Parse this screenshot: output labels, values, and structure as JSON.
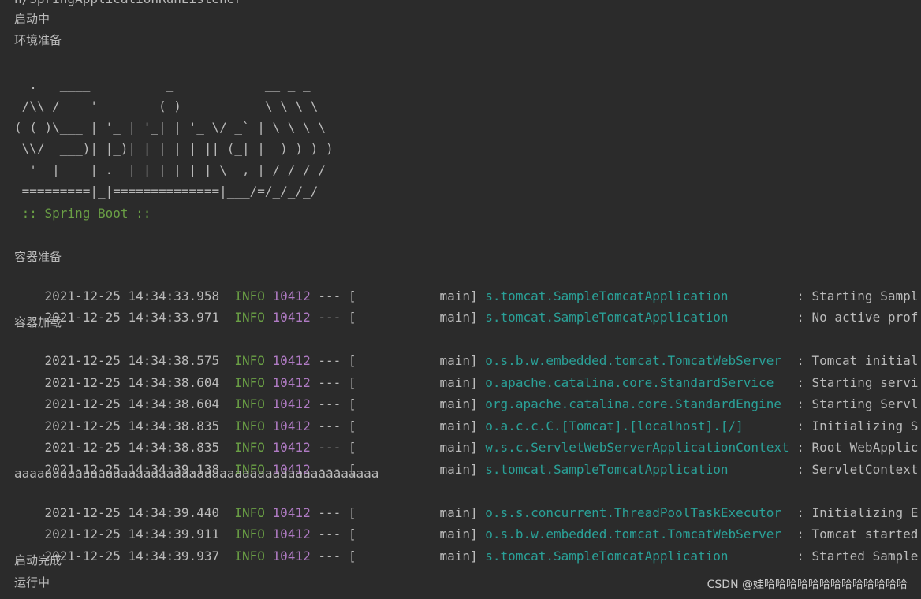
{
  "console": {
    "top_partial": "n/SpringApplicationRunListener",
    "pre_lines": [
      "启动中",
      "环境准备"
    ],
    "banner": [
      "  .   ____          _            __ _ _",
      " /\\\\ / ___'_ __ _ _(_)_ __  __ _ \\ \\ \\ \\",
      "( ( )\\___ | '_ | '_| | '_ \\/ _` | \\ \\ \\ \\",
      " \\\\/  ___)| |_)| | | | | || (_| |  ) ) ) )",
      "  '  |____| .__|_| |_|_| |_\\__, | / / / /",
      " =========|_|==============|___/=/_/_/_/",
      " :: Spring Boot :: "
    ],
    "section_container_prepare": "容器准备",
    "log_group_1": [
      {
        "ts": "2021-12-25 14:34:33.958",
        "level": "INFO",
        "pid": "10412",
        "thread": "main",
        "logger": "s.tomcat.SampleTomcatApplication",
        "msg": ": Starting Sampl"
      },
      {
        "ts": "2021-12-25 14:34:33.971",
        "level": "INFO",
        "pid": "10412",
        "thread": "main",
        "logger": "s.tomcat.SampleTomcatApplication",
        "msg": ": No active prof"
      }
    ],
    "section_container_load": "容器加载",
    "log_group_2": [
      {
        "ts": "2021-12-25 14:34:38.575",
        "level": "INFO",
        "pid": "10412",
        "thread": "main",
        "logger": "o.s.b.w.embedded.tomcat.TomcatWebServer",
        "msg": ": Tomcat initial"
      },
      {
        "ts": "2021-12-25 14:34:38.604",
        "level": "INFO",
        "pid": "10412",
        "thread": "main",
        "logger": "o.apache.catalina.core.StandardService",
        "msg": ": Starting servi"
      },
      {
        "ts": "2021-12-25 14:34:38.604",
        "level": "INFO",
        "pid": "10412",
        "thread": "main",
        "logger": "org.apache.catalina.core.StandardEngine",
        "msg": ": Starting Servl"
      },
      {
        "ts": "2021-12-25 14:34:38.835",
        "level": "INFO",
        "pid": "10412",
        "thread": "main",
        "logger": "o.a.c.c.C.[Tomcat].[localhost].[/]",
        "msg": ": Initializing S"
      },
      {
        "ts": "2021-12-25 14:34:38.835",
        "level": "INFO",
        "pid": "10412",
        "thread": "main",
        "logger": "w.s.c.ServletWebServerApplicationContext",
        "msg": ": Root WebApplic"
      },
      {
        "ts": "2021-12-25 14:34:39.138",
        "level": "INFO",
        "pid": "10412",
        "thread": "main",
        "logger": "s.tomcat.SampleTomcatApplication",
        "msg": ": ServletContext"
      }
    ],
    "aaa_line": "aaaaaaaaaaaaaaaaaaaaaaaaaaaaaaaaaaaaaaaaaaaaaaaa",
    "log_group_3": [
      {
        "ts": "2021-12-25 14:34:39.440",
        "level": "INFO",
        "pid": "10412",
        "thread": "main",
        "logger": "o.s.s.concurrent.ThreadPoolTaskExecutor",
        "msg": ": Initializing E"
      },
      {
        "ts": "2021-12-25 14:34:39.911",
        "level": "INFO",
        "pid": "10412",
        "thread": "main",
        "logger": "o.s.b.w.embedded.tomcat.TomcatWebServer",
        "msg": ": Tomcat started"
      },
      {
        "ts": "2021-12-25 14:34:39.937",
        "level": "INFO",
        "pid": "10412",
        "thread": "main",
        "logger": "s.tomcat.SampleTomcatApplication",
        "msg": ": Started Sample"
      }
    ],
    "post_lines": [
      "启动完成",
      "运行中"
    ]
  },
  "watermark": "CSDN @娃哈哈哈哈哈哈哈哈哈哈哈哈哈",
  "colors": {
    "background": "#2b2b2b",
    "text": "#bbbbbb",
    "level_info": "#6a9f45",
    "pid": "#b07bc4",
    "logger": "#2aa198",
    "spring_boot": "#6a9f45"
  }
}
